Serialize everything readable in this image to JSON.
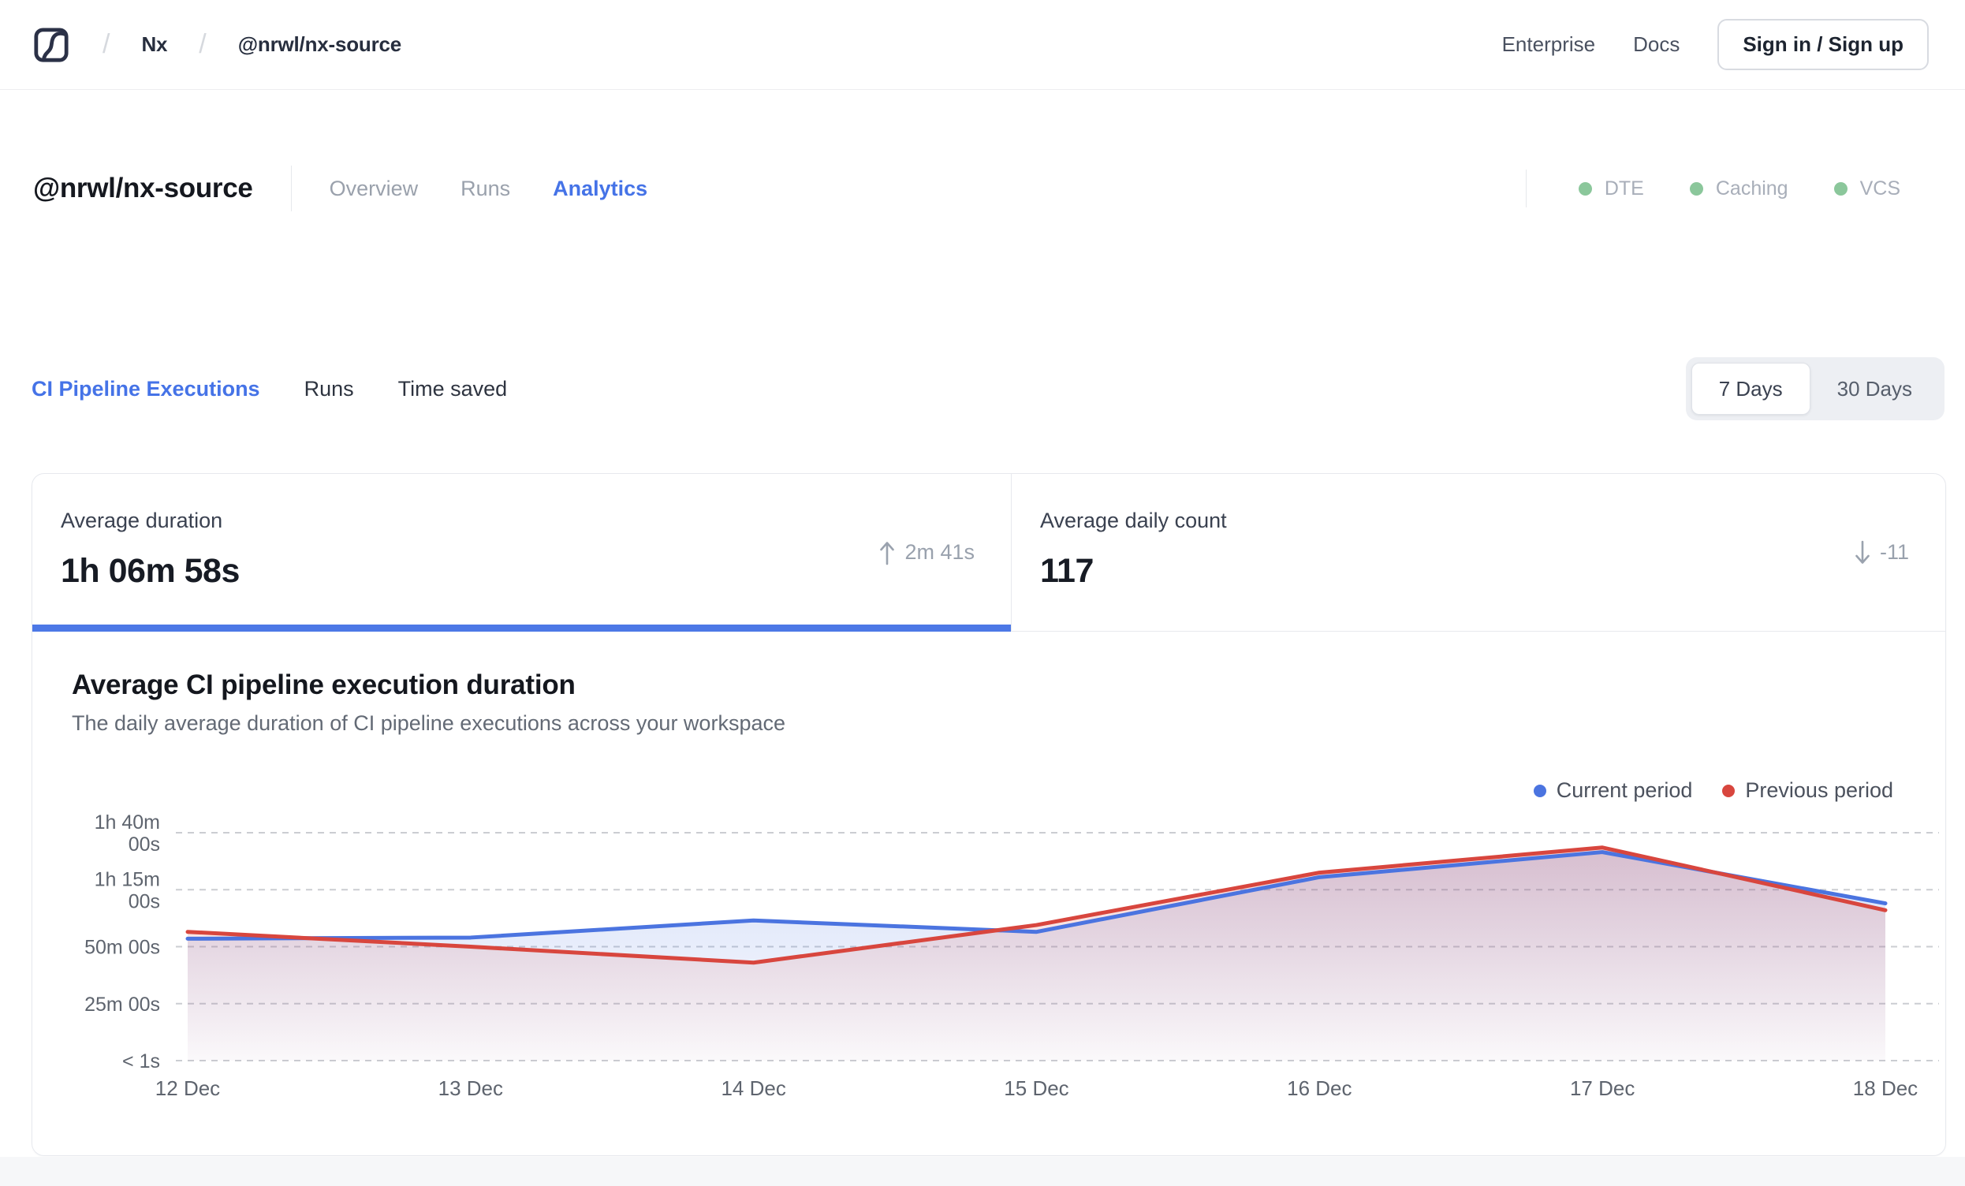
{
  "navbar": {
    "breadcrumb": {
      "separator": "/",
      "org": "Nx",
      "repo": "@nrwl/nx-source"
    },
    "links": [
      {
        "label": "Enterprise"
      },
      {
        "label": "Docs"
      }
    ],
    "signin_label": "Sign in / Sign up"
  },
  "header": {
    "title": "@nrwl/nx-source",
    "tabs": [
      {
        "label": "Overview",
        "active": false
      },
      {
        "label": "Runs",
        "active": false
      },
      {
        "label": "Analytics",
        "active": true
      }
    ],
    "features": [
      {
        "label": "DTE"
      },
      {
        "label": "Caching"
      },
      {
        "label": "VCS"
      }
    ],
    "feature_dot_color": "#8bc79b"
  },
  "metric_tabs": [
    {
      "label": "CI Pipeline Executions",
      "active": true
    },
    {
      "label": "Runs",
      "active": false
    },
    {
      "label": "Time saved",
      "active": false
    }
  ],
  "range_toggle": {
    "options": [
      {
        "label": "7 Days",
        "selected": true
      },
      {
        "label": "30 Days",
        "selected": false
      }
    ]
  },
  "stat_cards": [
    {
      "label": "Average duration",
      "value": "1h 06m 58s",
      "delta": "2m 41s",
      "direction": "up",
      "active": true
    },
    {
      "label": "Average daily count",
      "value": "117",
      "delta": "-11",
      "direction": "down",
      "active": false
    }
  ],
  "chart": {
    "title": "Average CI pipeline execution duration",
    "subtitle": "The daily average duration of CI pipeline executions across your workspace",
    "legend": [
      {
        "label": "Current period",
        "color": "#4b74e0"
      },
      {
        "label": "Previous period",
        "color": "#d8463e"
      }
    ]
  },
  "chart_data": {
    "type": "area",
    "unit": "minutes",
    "title": "Average CI pipeline execution duration",
    "categories": [
      "12 Dec",
      "13 Dec",
      "14 Dec",
      "15 Dec",
      "16 Dec",
      "17 Dec",
      "18 Dec"
    ],
    "series": [
      {
        "name": "Current period",
        "color": "#4b74e0",
        "values": [
          53.5,
          54,
          61.5,
          56.5,
          80.5,
          91.5,
          69
        ]
      },
      {
        "name": "Previous period",
        "color": "#d8463e",
        "values": [
          56.5,
          50,
          43,
          59.5,
          82.5,
          93.5,
          66
        ]
      }
    ],
    "y_ticks": [
      {
        "value": 100,
        "label": [
          "1h 40m",
          "00s"
        ]
      },
      {
        "value": 75,
        "label": [
          "1h 15m",
          "00s"
        ]
      },
      {
        "value": 50,
        "label": [
          "50m 00s"
        ]
      },
      {
        "value": 25,
        "label": [
          "25m 00s"
        ]
      },
      {
        "value": 0,
        "label": [
          "< 1s"
        ]
      }
    ],
    "ylim": [
      0,
      100
    ],
    "grid": "horizontal-dashed",
    "legend_position": "top-right"
  },
  "colors": {
    "accent_blue": "#4573e7",
    "active_bar": "#4c78e6",
    "green_status_dot": "#8bc79b",
    "grid_line": "#cbcdd2",
    "axis_text": "#5e646e"
  }
}
